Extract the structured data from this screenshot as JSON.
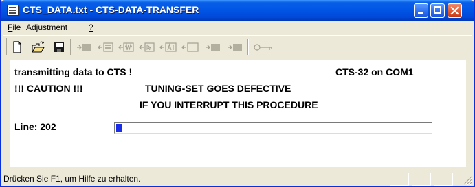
{
  "window": {
    "title": "CTS_DATA.txt - CTS-DATA-TRANSFER",
    "titlebar_color": "#0055e5",
    "close_color": "#e0552c"
  },
  "menu": {
    "file_mnemonic": "F",
    "file_rest": "ile",
    "adjustment": "Adjustment",
    "help": "?"
  },
  "toolbar": {
    "icons": [
      "new-document-icon",
      "open-folder-icon",
      "save-disk-icon",
      "disabled-send-icon",
      "disabled-display-icon",
      "disabled-waveform-icon",
      "disabled-cursor-icon",
      "disabled-ai-icon",
      "disabled-frame-icon",
      "disabled-block-icon",
      "disabled-block-icon",
      "disabled-key-icon"
    ]
  },
  "status_panel": {
    "message": "transmitting data to CTS !",
    "port": "CTS-32 on COM1",
    "caution": "!!! CAUTION !!!",
    "warning_line1": "TUNING-SET GOES DEFECTIVE",
    "warning_line2": "IF YOU INTERRUPT THIS PROCEDURE",
    "line_label": "Line: 202",
    "progress_fraction": 0.02,
    "progress_color": "#1a2ee6"
  },
  "statusbar": {
    "text": "Drücken Sie F1, um Hilfe zu erhalten."
  }
}
